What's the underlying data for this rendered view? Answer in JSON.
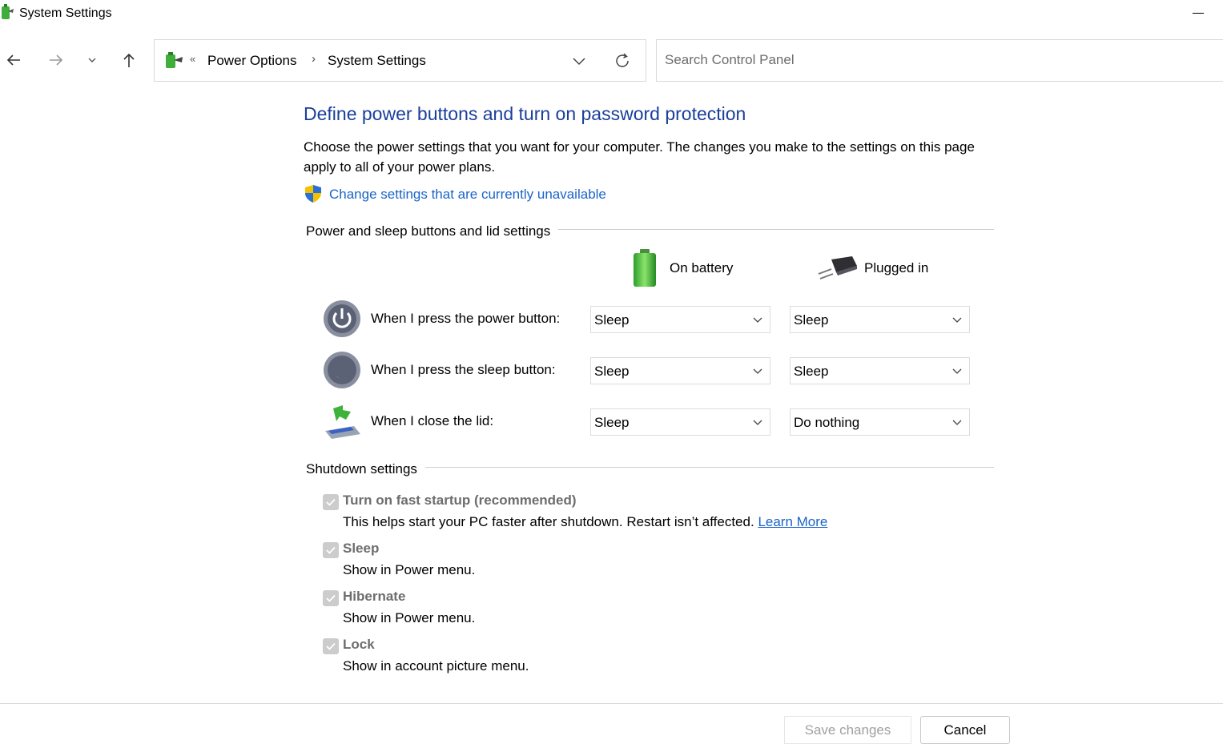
{
  "window": {
    "title": "System Settings"
  },
  "nav": {
    "breadcrumb_overflow": "«",
    "breadcrumbs": [
      "Power Options",
      "System Settings"
    ],
    "breadcrumb_separator": "›",
    "search_placeholder": "Search Control Panel"
  },
  "page": {
    "heading": "Define power buttons and turn on password protection",
    "description": "Choose the power settings that you want for your computer. The changes you make to the settings on this page apply to all of your power plans.",
    "change_link": "Change settings that are currently unavailable"
  },
  "power_section": {
    "label": "Power and sleep buttons and lid settings",
    "columns": [
      "On battery",
      "Plugged in"
    ],
    "rows": [
      {
        "label": "When I press the power button:",
        "icon": "power-button-icon",
        "battery": "Sleep",
        "plugged": "Sleep"
      },
      {
        "label": "When I press the sleep button:",
        "icon": "sleep-button-icon",
        "battery": "Sleep",
        "plugged": "Sleep"
      },
      {
        "label": "When I close the lid:",
        "icon": "laptop-lid-icon",
        "battery": "Sleep",
        "plugged": "Do nothing"
      }
    ]
  },
  "shutdown_section": {
    "label": "Shutdown settings",
    "items": [
      {
        "title": "Turn on fast startup (recommended)",
        "sub": "This helps start your PC faster after shutdown. Restart isn’t affected.",
        "link": "Learn More",
        "checked": true
      },
      {
        "title": "Sleep",
        "sub": "Show in Power menu.",
        "checked": true
      },
      {
        "title": "Hibernate",
        "sub": "Show in Power menu.",
        "checked": true
      },
      {
        "title": "Lock",
        "sub": "Show in account picture menu.",
        "checked": true
      }
    ]
  },
  "footer": {
    "save_label": "Save changes",
    "cancel_label": "Cancel"
  },
  "colors": {
    "heading": "#1a3e9a",
    "link": "#1a64c8",
    "disabled_text": "#6d6d6d",
    "checkbox_disabled": "#cccccc"
  }
}
